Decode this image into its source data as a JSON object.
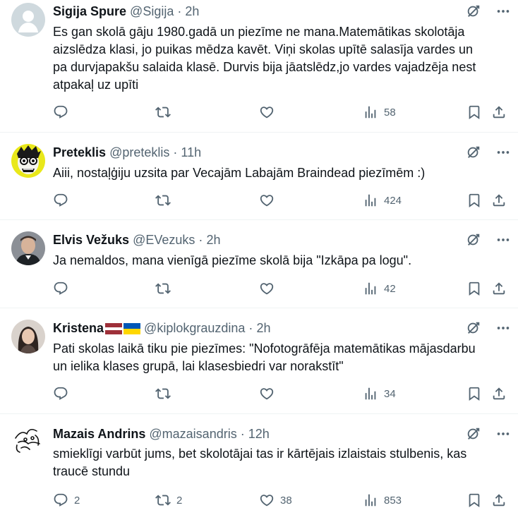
{
  "tweets": [
    {
      "name": "Sigija Spure",
      "handle": "@Sigija",
      "dot": "·",
      "time": "2h",
      "text_lines": [
        "Es gan skolā gāju 1980.gadā un piezīme ne mana.Matemātikas skolotāja",
        "aizslēdza klasi, jo puikas mēdza kavēt. Viņi skolas  upītē salasīja vardes un",
        "pa durvjapakšu salaida klasē. Durvis bija jāatslēdz,jo vardes vajadzēja nest",
        "atpakaļ uz upīti"
      ],
      "replies": "",
      "reposts": "",
      "likes": "",
      "views": "58"
    },
    {
      "name": "Preteklis",
      "handle": "@preteklis",
      "dot": "·",
      "time": "11h",
      "text_lines": [
        "Aiii, nostaļģiju uzsita par Vecajām Labajām Braindead piezīmēm :)"
      ],
      "replies": "",
      "reposts": "",
      "likes": "",
      "views": "424"
    },
    {
      "name": "Elvis Vežuks",
      "handle": "@EVezuks",
      "dot": "·",
      "time": "2h",
      "text_lines": [
        "Ja nemaldos, mana vienīgā piezīme skolā bija \"Izkāpa pa logu\"."
      ],
      "replies": "",
      "reposts": "",
      "likes": "",
      "views": "42"
    },
    {
      "name": "Kristena",
      "handle": "@kiplokgrauzdina",
      "dot": "·",
      "time": "2h",
      "text_lines": [
        "Pati skolas laikā tiku pie piezīmes: \"Nofotogrāfēja matemātikas mājasdarbu",
        "un ielika klases grupā, lai klasesbiedri var norakstīt\""
      ],
      "replies": "",
      "reposts": "",
      "likes": "",
      "views": "34",
      "name_flags": [
        "latvia-flag",
        "ukraine-flag"
      ]
    },
    {
      "name": "Mazais Andrins",
      "handle": "@mazaisandris",
      "dot": "·",
      "time": "12h",
      "text_lines": [
        "smieklīgi varbūt jums, bet skolotājai tas ir kārtējais izlaistais stulbenis, kas",
        "traucē stundu"
      ],
      "replies": "2",
      "reposts": "2",
      "likes": "38",
      "views": "853"
    }
  ],
  "colors": {
    "text": "#0f1419",
    "secondary": "#536471",
    "divider": "#eff3f4",
    "latvia_red": "#9e3039",
    "ukraine_blue": "#0057b7",
    "ukraine_yellow": "#ffd700"
  },
  "icons": [
    "grok-icon",
    "more-icon",
    "reply-icon",
    "repost-icon",
    "like-icon",
    "views-icon",
    "bookmark-icon",
    "share-icon"
  ]
}
